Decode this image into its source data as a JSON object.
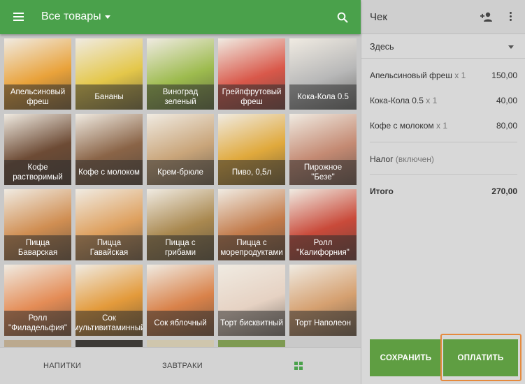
{
  "header": {
    "category": "Все товары"
  },
  "products": [
    {
      "label": "Апельсиновый фреш",
      "color": "#e9a23a"
    },
    {
      "label": "Бананы",
      "color": "#e4c74a"
    },
    {
      "label": "Виноград зеленый",
      "color": "#9dbb4e"
    },
    {
      "label": "Грейпфрутовый фреш",
      "color": "#d9584a"
    },
    {
      "label": "Кока-Кола 0.5",
      "color": "#b8b8b8"
    },
    {
      "label": "Кофе растворимый",
      "color": "#6d4b35"
    },
    {
      "label": "Кофе с молоком",
      "color": "#8a6447"
    },
    {
      "label": "Крем-брюле",
      "color": "#c9a57a"
    },
    {
      "label": "Пиво, 0,5л",
      "color": "#e0a93c"
    },
    {
      "label": "Пирожное \"Безе\"",
      "color": "#c48a73"
    },
    {
      "label": "Пицца Баварская",
      "color": "#d08e52"
    },
    {
      "label": "Пицца Гавайская",
      "color": "#dea05e"
    },
    {
      "label": "Пицца с грибами",
      "color": "#a9884f"
    },
    {
      "label": "Пицца с морепродуктами",
      "color": "#c27a4a"
    },
    {
      "label": "Ролл \"Калифорния\"",
      "color": "#c94a3a"
    },
    {
      "label": "Ролл \"Филадельфия\"",
      "color": "#e48c56"
    },
    {
      "label": "Сок мультивитаминный",
      "color": "#e39a3b"
    },
    {
      "label": "Сок яблочный",
      "color": "#d9824a"
    },
    {
      "label": "Торт бисквитный",
      "color": "#e6d2c3"
    },
    {
      "label": "Торт Наполеон",
      "color": "#d5a070"
    }
  ],
  "bottom_nav": {
    "tab1": "НАПИТКИ",
    "tab2": "ЗАВТРАКИ"
  },
  "receipt": {
    "title": "Чек",
    "place": "Здесь",
    "items": [
      {
        "name": "Апельсиновый фреш",
        "qty": "x 1",
        "price": "150,00"
      },
      {
        "name": "Кока-Кола 0.5",
        "qty": "x 1",
        "price": "40,00"
      },
      {
        "name": "Кофе с молоком",
        "qty": "x 1",
        "price": "80,00"
      }
    ],
    "tax_label": "Налог",
    "tax_note": "(включен)",
    "total_label": "Итого",
    "total_value": "270,00",
    "save_label": "СОХРАНИТЬ",
    "pay_label": "ОПЛАТИТЬ"
  },
  "colors": {
    "accent": "#4aa14b",
    "button": "#5f9e42",
    "highlight": "#e58a3e"
  }
}
